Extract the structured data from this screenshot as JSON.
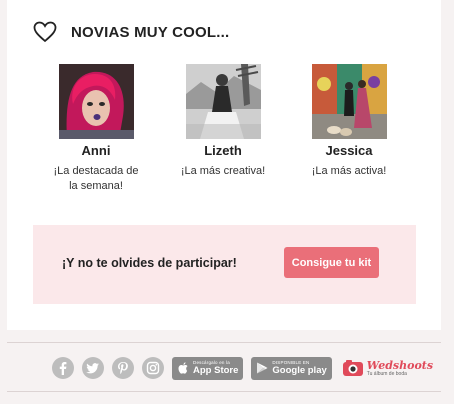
{
  "section": {
    "title": "NOVIAS MUY COOL..."
  },
  "brides": [
    {
      "name": "Anni",
      "caption_line1": "¡La destacada de",
      "caption_line2": "la semana!"
    },
    {
      "name": "Lizeth",
      "caption_line1": "¡La más creativa!",
      "caption_line2": ""
    },
    {
      "name": "Jessica",
      "caption_line1": "¡La más activa!",
      "caption_line2": ""
    }
  ],
  "cta": {
    "text": "¡Y no te olvides de participar!",
    "button_label": "Consigue tu kit"
  },
  "footer": {
    "social_icons": [
      "facebook-icon",
      "twitter-icon",
      "pinterest-icon",
      "instagram-icon"
    ],
    "app_store": {
      "small": "Descárgalo en la",
      "big": "App Store"
    },
    "google_play": {
      "small": "DISPONIBLE EN",
      "big": "Google play"
    },
    "brand": {
      "name": "Wedshoots",
      "tagline": "Tu álbum de boda"
    }
  },
  "colors": {
    "accent": "#ea6f79",
    "cta_bg": "#fbe8ea",
    "page_bg": "#f6f2f2",
    "icon_gray": "#bdbdbd"
  }
}
